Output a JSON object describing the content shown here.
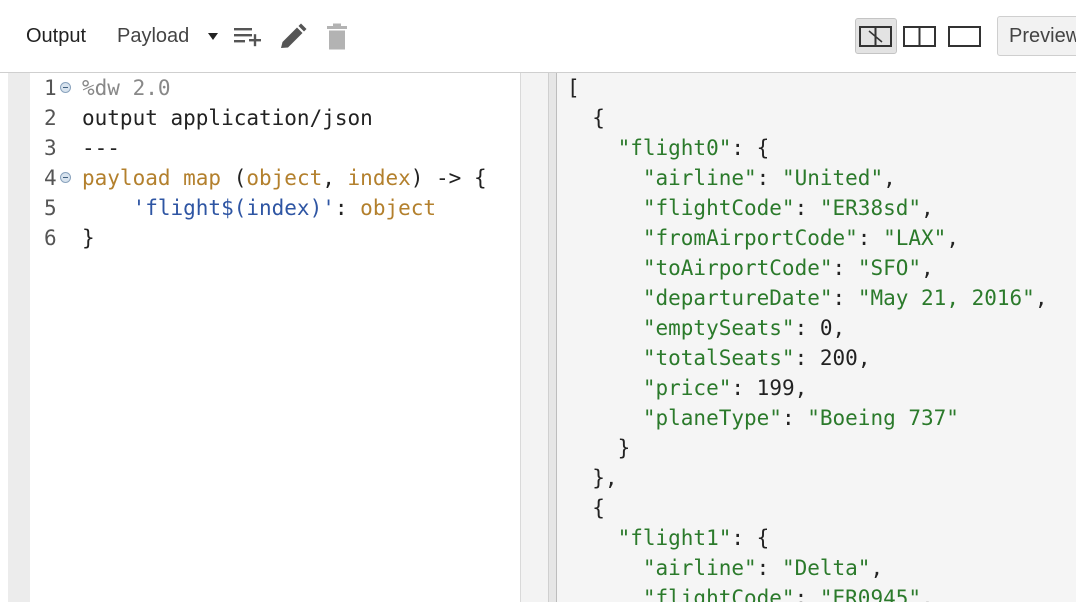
{
  "toolbar": {
    "output_label": "Output",
    "payload_label": "Payload",
    "preview_label": "Preview",
    "icons": [
      "add-list-icon",
      "pencil-icon",
      "trash-icon",
      "layout-split-active-icon",
      "layout-split-icon",
      "layout-single-icon"
    ]
  },
  "editor": {
    "lines": [
      {
        "num": "1",
        "fold": true,
        "tokens": [
          {
            "t": "%dw 2.0",
            "c": "dir"
          }
        ]
      },
      {
        "num": "2",
        "fold": false,
        "tokens": [
          {
            "t": "output application/json",
            "c": "plain"
          }
        ]
      },
      {
        "num": "3",
        "fold": false,
        "tokens": [
          {
            "t": "---",
            "c": "plain"
          }
        ]
      },
      {
        "num": "4",
        "fold": true,
        "tokens": [
          {
            "t": "payload map",
            "c": "kw"
          },
          {
            "t": " (",
            "c": "plain"
          },
          {
            "t": "object",
            "c": "kw"
          },
          {
            "t": ", ",
            "c": "plain"
          },
          {
            "t": "index",
            "c": "kw"
          },
          {
            "t": ") -> {",
            "c": "plain"
          }
        ]
      },
      {
        "num": "5",
        "fold": false,
        "tokens": [
          {
            "t": "    'flight$(index)'",
            "c": "str"
          },
          {
            "t": ": ",
            "c": "plain"
          },
          {
            "t": "object",
            "c": "kw"
          }
        ]
      },
      {
        "num": "6",
        "fold": false,
        "tokens": [
          {
            "t": "}",
            "c": "plain"
          }
        ]
      }
    ]
  },
  "output": {
    "lines": [
      [
        {
          "t": "[",
          "c": "p"
        }
      ],
      [
        {
          "t": "  {",
          "c": "p"
        }
      ],
      [
        {
          "t": "    ",
          "c": "p"
        },
        {
          "t": "\"flight0\"",
          "c": "key"
        },
        {
          "t": ": {",
          "c": "p"
        }
      ],
      [
        {
          "t": "      ",
          "c": "p"
        },
        {
          "t": "\"airline\"",
          "c": "key"
        },
        {
          "t": ": ",
          "c": "p"
        },
        {
          "t": "\"United\"",
          "c": "str"
        },
        {
          "t": ",",
          "c": "p"
        }
      ],
      [
        {
          "t": "      ",
          "c": "p"
        },
        {
          "t": "\"flightCode\"",
          "c": "key"
        },
        {
          "t": ": ",
          "c": "p"
        },
        {
          "t": "\"ER38sd\"",
          "c": "str"
        },
        {
          "t": ",",
          "c": "p"
        }
      ],
      [
        {
          "t": "      ",
          "c": "p"
        },
        {
          "t": "\"fromAirportCode\"",
          "c": "key"
        },
        {
          "t": ": ",
          "c": "p"
        },
        {
          "t": "\"LAX\"",
          "c": "str"
        },
        {
          "t": ",",
          "c": "p"
        }
      ],
      [
        {
          "t": "      ",
          "c": "p"
        },
        {
          "t": "\"toAirportCode\"",
          "c": "key"
        },
        {
          "t": ": ",
          "c": "p"
        },
        {
          "t": "\"SFO\"",
          "c": "str"
        },
        {
          "t": ",",
          "c": "p"
        }
      ],
      [
        {
          "t": "      ",
          "c": "p"
        },
        {
          "t": "\"departureDate\"",
          "c": "key"
        },
        {
          "t": ": ",
          "c": "p"
        },
        {
          "t": "\"May 21, 2016\"",
          "c": "str"
        },
        {
          "t": ",",
          "c": "p"
        }
      ],
      [
        {
          "t": "      ",
          "c": "p"
        },
        {
          "t": "\"emptySeats\"",
          "c": "key"
        },
        {
          "t": ": ",
          "c": "p"
        },
        {
          "t": "0",
          "c": "num"
        },
        {
          "t": ",",
          "c": "p"
        }
      ],
      [
        {
          "t": "      ",
          "c": "p"
        },
        {
          "t": "\"totalSeats\"",
          "c": "key"
        },
        {
          "t": ": ",
          "c": "p"
        },
        {
          "t": "200",
          "c": "num"
        },
        {
          "t": ",",
          "c": "p"
        }
      ],
      [
        {
          "t": "      ",
          "c": "p"
        },
        {
          "t": "\"price\"",
          "c": "key"
        },
        {
          "t": ": ",
          "c": "p"
        },
        {
          "t": "199",
          "c": "num"
        },
        {
          "t": ",",
          "c": "p"
        }
      ],
      [
        {
          "t": "      ",
          "c": "p"
        },
        {
          "t": "\"planeType\"",
          "c": "key"
        },
        {
          "t": ": ",
          "c": "p"
        },
        {
          "t": "\"Boeing 737\"",
          "c": "str"
        }
      ],
      [
        {
          "t": "    }",
          "c": "p"
        }
      ],
      [
        {
          "t": "  },",
          "c": "p"
        }
      ],
      [
        {
          "t": "  {",
          "c": "p"
        }
      ],
      [
        {
          "t": "    ",
          "c": "p"
        },
        {
          "t": "\"flight1\"",
          "c": "key"
        },
        {
          "t": ": {",
          "c": "p"
        }
      ],
      [
        {
          "t": "      ",
          "c": "p"
        },
        {
          "t": "\"airline\"",
          "c": "key"
        },
        {
          "t": ": ",
          "c": "p"
        },
        {
          "t": "\"Delta\"",
          "c": "str"
        },
        {
          "t": ",",
          "c": "p"
        }
      ],
      [
        {
          "t": "      ",
          "c": "p"
        },
        {
          "t": "\"flightCode\"",
          "c": "key"
        },
        {
          "t": ": ",
          "c": "p"
        },
        {
          "t": "\"ER0945\"",
          "c": "str"
        },
        {
          "t": ",",
          "c": "p"
        }
      ]
    ]
  }
}
